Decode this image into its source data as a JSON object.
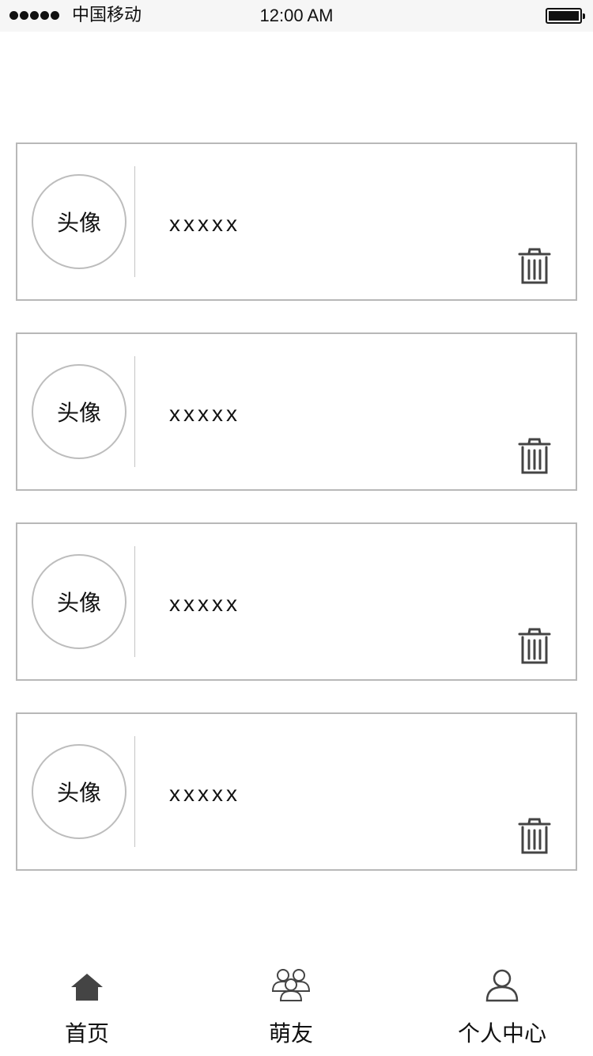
{
  "status_bar": {
    "carrier": "中国移动",
    "time": "12:00 AM",
    "signal_dots": 5
  },
  "list": {
    "items": [
      {
        "avatar_label": "头像",
        "name": "xxxxx"
      },
      {
        "avatar_label": "头像",
        "name": "xxxxx"
      },
      {
        "avatar_label": "头像",
        "name": "xxxxx"
      },
      {
        "avatar_label": "头像",
        "name": "xxxxx"
      }
    ],
    "delete_icon": "trash-icon"
  },
  "tab_bar": {
    "tabs": [
      {
        "label": "首页",
        "icon": "home-icon"
      },
      {
        "label": "萌友",
        "icon": "friends-icon"
      },
      {
        "label": "个人中心",
        "icon": "user-icon"
      }
    ]
  },
  "colors": {
    "border": "#b8b8b8",
    "text": "#111111",
    "icon": "#444444",
    "status_bar_bg": "#f6f6f6"
  }
}
